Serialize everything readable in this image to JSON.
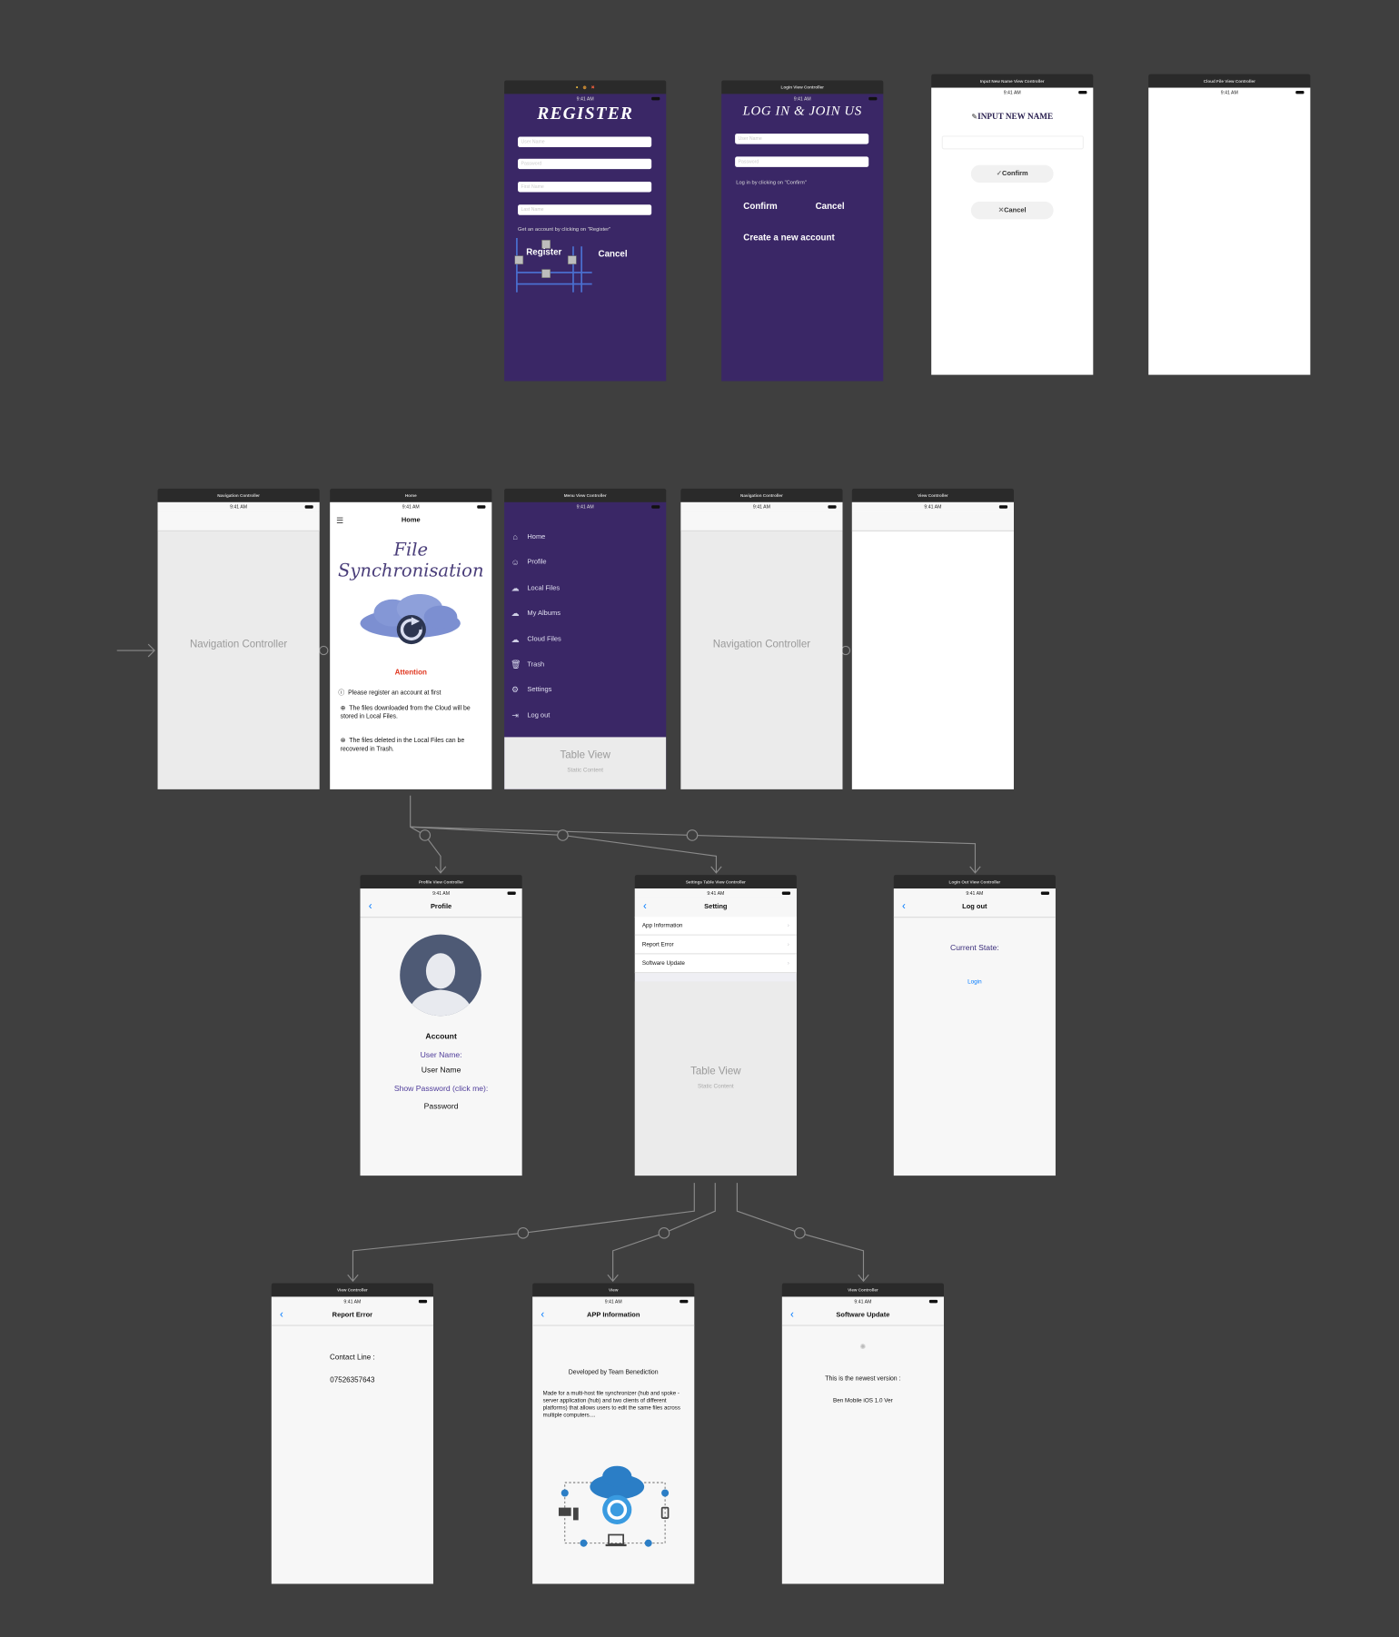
{
  "register": {
    "bar_dots": [
      "●",
      "◍",
      "✖"
    ],
    "status_time": "9:41 AM",
    "title": "REGISTER",
    "user_name_placeholder": "User Name",
    "password_placeholder": "Password",
    "first_name_placeholder": "First Name",
    "last_name_placeholder": "Last Name",
    "hint": "Get an account by clicking on \"Register\"",
    "register_label": "Register",
    "cancel_label": "Cancel"
  },
  "login": {
    "bar_title": "Login View Controller",
    "status_time": "9:41 AM",
    "title": "LOG IN & JOIN US",
    "user_name_placeholder": "User Name",
    "password_placeholder": "Password",
    "hint": "Log in by clicking on \"Confirm\"",
    "confirm_label": "Confirm",
    "cancel_label": "Cancel",
    "create_label": "Create a new account"
  },
  "input_name": {
    "bar_title": "Input New Name View Controller",
    "status_time": "9:41 AM",
    "title": "INPUT NEW NAME",
    "confirm_label": "Confirm",
    "cancel_label": "Cancel"
  },
  "cloud_file": {
    "bar_title": "Cloud File View Controller",
    "status_time": "9:41 AM"
  },
  "nav_controller_1": {
    "bar_title": "Navigation Controller",
    "status_time": "9:41 AM",
    "label": "Navigation Controller"
  },
  "home": {
    "bar_title": "Home",
    "status_time": "9:41 AM",
    "nav_title": "Home",
    "logo_text": "File Synchronisation",
    "attention": "Attention",
    "note_1": "Please register an account at first",
    "note_2": "The files downloaded    from the Cloud will be stored in Local Files.",
    "note_3": "The files deleted in the Local Files can be recovered in Trash."
  },
  "menu": {
    "bar_title": "Menu View Controller",
    "status_time": "9:41 AM",
    "items": [
      {
        "label": "Home",
        "icon": "home-icon"
      },
      {
        "label": "Profile",
        "icon": "profile-icon"
      },
      {
        "label": "Local Files",
        "icon": "cloud-download-icon"
      },
      {
        "label": "My Albums",
        "icon": "cloud-icon"
      },
      {
        "label": "Cloud Files",
        "icon": "cloud-upload-icon"
      },
      {
        "label": "Trash",
        "icon": "trash-icon"
      },
      {
        "label": "Settings",
        "icon": "gear-icon"
      },
      {
        "label": "Log out",
        "icon": "logout-icon"
      }
    ],
    "table_view": "Table View",
    "static_content": "Static Content"
  },
  "nav_controller_2": {
    "bar_title": "Navigation Controller",
    "status_time": "9:41 AM",
    "label": "Navigation Controller"
  },
  "view_controller_top": {
    "bar_title": "View Controller",
    "status_time": "9:41 AM"
  },
  "profile": {
    "bar_title": "Profile View Controller",
    "status_time": "9:41 AM",
    "nav_title": "Profile",
    "account": "Account",
    "user_name_label": "User Name:",
    "user_name_value": "User Name",
    "show_password": "Show Password (click me):",
    "password_value": "Password"
  },
  "settings": {
    "bar_title": "Settings Table View Controller",
    "status_time": "9:41 AM",
    "nav_title": "Setting",
    "rows": [
      "App Information",
      "Report Error",
      "Software Update"
    ],
    "table_view": "Table View",
    "static_content": "Static Content"
  },
  "logout": {
    "bar_title": "Login Out View Controller",
    "status_time": "9:41 AM",
    "nav_title": "Log out",
    "current_state": "Current State:",
    "login_link": "Login"
  },
  "report_error": {
    "bar_title": "View Controller",
    "status_time": "9:41 AM",
    "nav_title": "Report Error",
    "contact_label": "Contact Line :",
    "contact_value": "07526357643"
  },
  "app_info": {
    "bar_title": "View",
    "status_time": "9:41 AM",
    "nav_title": "APP Information",
    "developer": "Developed by Team Benediction",
    "description": "Made for a multi-host file synchronizer (hub and spoke - server application (hub) and two clients of different platforms) that allows users to edit the same files across multiple computers...."
  },
  "software_update": {
    "bar_title": "View Controller",
    "status_time": "9:41 AM",
    "nav_title": "Software Update",
    "newest": "This is the newest version :",
    "version": "Ben Mobile iOS 1.0 Ver"
  },
  "colors": {
    "canvas": "#3f3f3f",
    "purple": "#3a2766",
    "accent_blue": "#007aff",
    "attention_red": "#e0351e",
    "link_purple": "#4f3c9a"
  }
}
